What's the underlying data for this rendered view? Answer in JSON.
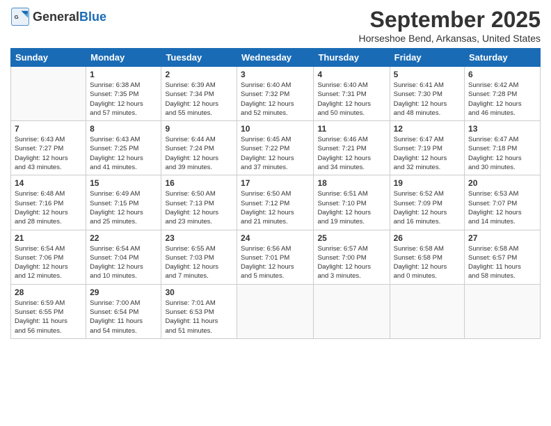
{
  "header": {
    "logo_general": "General",
    "logo_blue": "Blue",
    "month": "September 2025",
    "location": "Horseshoe Bend, Arkansas, United States"
  },
  "days_of_week": [
    "Sunday",
    "Monday",
    "Tuesday",
    "Wednesday",
    "Thursday",
    "Friday",
    "Saturday"
  ],
  "weeks": [
    [
      {
        "day": "",
        "detail": ""
      },
      {
        "day": "1",
        "detail": "Sunrise: 6:38 AM\nSunset: 7:35 PM\nDaylight: 12 hours\nand 57 minutes."
      },
      {
        "day": "2",
        "detail": "Sunrise: 6:39 AM\nSunset: 7:34 PM\nDaylight: 12 hours\nand 55 minutes."
      },
      {
        "day": "3",
        "detail": "Sunrise: 6:40 AM\nSunset: 7:32 PM\nDaylight: 12 hours\nand 52 minutes."
      },
      {
        "day": "4",
        "detail": "Sunrise: 6:40 AM\nSunset: 7:31 PM\nDaylight: 12 hours\nand 50 minutes."
      },
      {
        "day": "5",
        "detail": "Sunrise: 6:41 AM\nSunset: 7:30 PM\nDaylight: 12 hours\nand 48 minutes."
      },
      {
        "day": "6",
        "detail": "Sunrise: 6:42 AM\nSunset: 7:28 PM\nDaylight: 12 hours\nand 46 minutes."
      }
    ],
    [
      {
        "day": "7",
        "detail": "Sunrise: 6:43 AM\nSunset: 7:27 PM\nDaylight: 12 hours\nand 43 minutes."
      },
      {
        "day": "8",
        "detail": "Sunrise: 6:43 AM\nSunset: 7:25 PM\nDaylight: 12 hours\nand 41 minutes."
      },
      {
        "day": "9",
        "detail": "Sunrise: 6:44 AM\nSunset: 7:24 PM\nDaylight: 12 hours\nand 39 minutes."
      },
      {
        "day": "10",
        "detail": "Sunrise: 6:45 AM\nSunset: 7:22 PM\nDaylight: 12 hours\nand 37 minutes."
      },
      {
        "day": "11",
        "detail": "Sunrise: 6:46 AM\nSunset: 7:21 PM\nDaylight: 12 hours\nand 34 minutes."
      },
      {
        "day": "12",
        "detail": "Sunrise: 6:47 AM\nSunset: 7:19 PM\nDaylight: 12 hours\nand 32 minutes."
      },
      {
        "day": "13",
        "detail": "Sunrise: 6:47 AM\nSunset: 7:18 PM\nDaylight: 12 hours\nand 30 minutes."
      }
    ],
    [
      {
        "day": "14",
        "detail": "Sunrise: 6:48 AM\nSunset: 7:16 PM\nDaylight: 12 hours\nand 28 minutes."
      },
      {
        "day": "15",
        "detail": "Sunrise: 6:49 AM\nSunset: 7:15 PM\nDaylight: 12 hours\nand 25 minutes."
      },
      {
        "day": "16",
        "detail": "Sunrise: 6:50 AM\nSunset: 7:13 PM\nDaylight: 12 hours\nand 23 minutes."
      },
      {
        "day": "17",
        "detail": "Sunrise: 6:50 AM\nSunset: 7:12 PM\nDaylight: 12 hours\nand 21 minutes."
      },
      {
        "day": "18",
        "detail": "Sunrise: 6:51 AM\nSunset: 7:10 PM\nDaylight: 12 hours\nand 19 minutes."
      },
      {
        "day": "19",
        "detail": "Sunrise: 6:52 AM\nSunset: 7:09 PM\nDaylight: 12 hours\nand 16 minutes."
      },
      {
        "day": "20",
        "detail": "Sunrise: 6:53 AM\nSunset: 7:07 PM\nDaylight: 12 hours\nand 14 minutes."
      }
    ],
    [
      {
        "day": "21",
        "detail": "Sunrise: 6:54 AM\nSunset: 7:06 PM\nDaylight: 12 hours\nand 12 minutes."
      },
      {
        "day": "22",
        "detail": "Sunrise: 6:54 AM\nSunset: 7:04 PM\nDaylight: 12 hours\nand 10 minutes."
      },
      {
        "day": "23",
        "detail": "Sunrise: 6:55 AM\nSunset: 7:03 PM\nDaylight: 12 hours\nand 7 minutes."
      },
      {
        "day": "24",
        "detail": "Sunrise: 6:56 AM\nSunset: 7:01 PM\nDaylight: 12 hours\nand 5 minutes."
      },
      {
        "day": "25",
        "detail": "Sunrise: 6:57 AM\nSunset: 7:00 PM\nDaylight: 12 hours\nand 3 minutes."
      },
      {
        "day": "26",
        "detail": "Sunrise: 6:58 AM\nSunset: 6:58 PM\nDaylight: 12 hours\nand 0 minutes."
      },
      {
        "day": "27",
        "detail": "Sunrise: 6:58 AM\nSunset: 6:57 PM\nDaylight: 11 hours\nand 58 minutes."
      }
    ],
    [
      {
        "day": "28",
        "detail": "Sunrise: 6:59 AM\nSunset: 6:55 PM\nDaylight: 11 hours\nand 56 minutes."
      },
      {
        "day": "29",
        "detail": "Sunrise: 7:00 AM\nSunset: 6:54 PM\nDaylight: 11 hours\nand 54 minutes."
      },
      {
        "day": "30",
        "detail": "Sunrise: 7:01 AM\nSunset: 6:53 PM\nDaylight: 11 hours\nand 51 minutes."
      },
      {
        "day": "",
        "detail": ""
      },
      {
        "day": "",
        "detail": ""
      },
      {
        "day": "",
        "detail": ""
      },
      {
        "day": "",
        "detail": ""
      }
    ]
  ]
}
